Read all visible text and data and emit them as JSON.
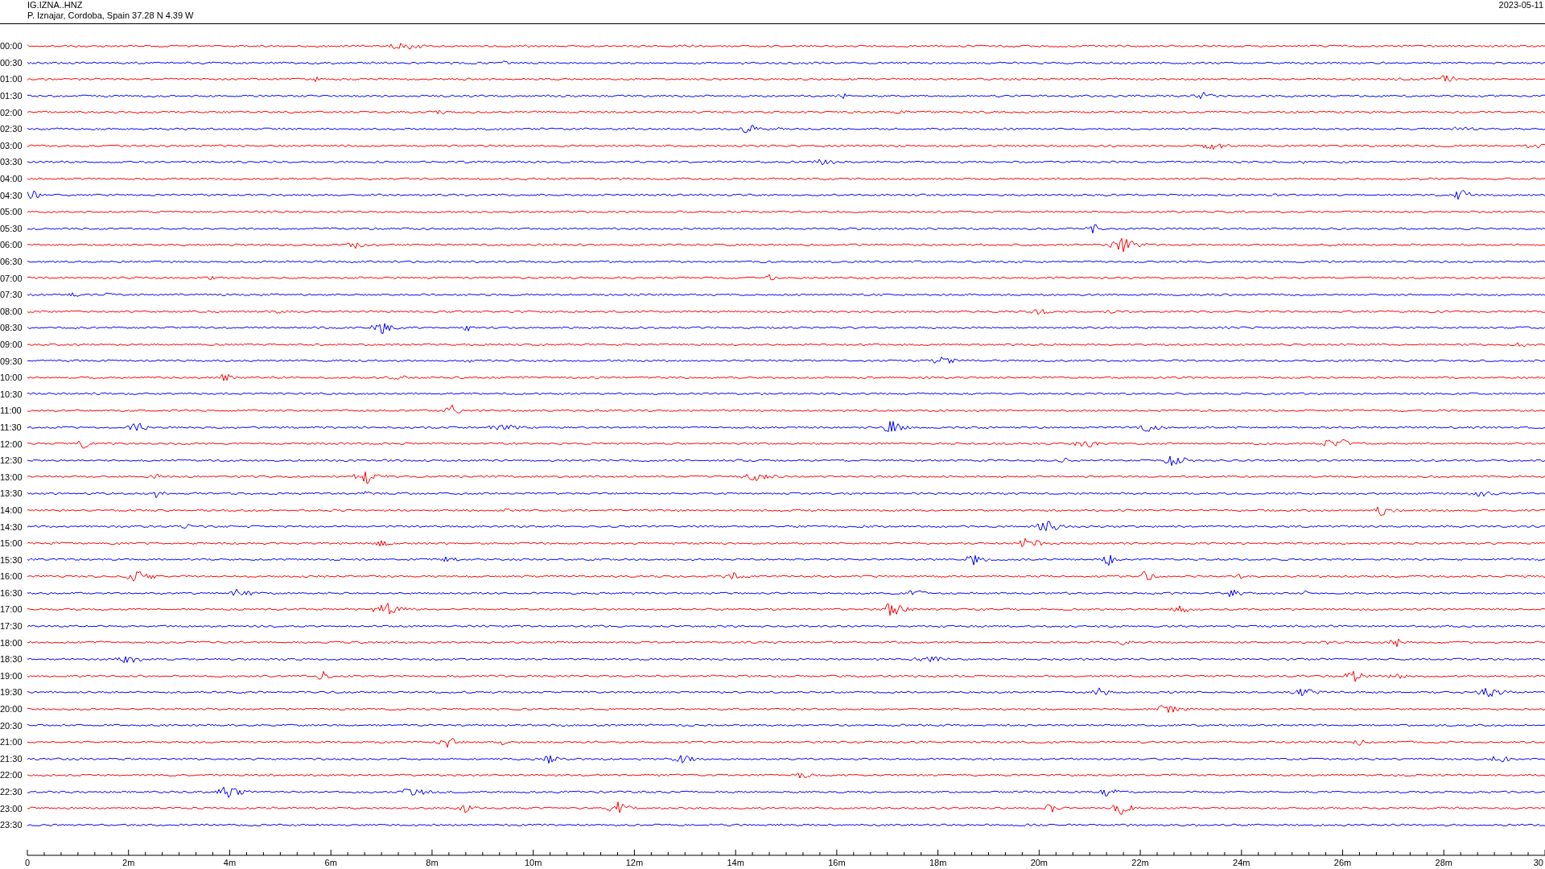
{
  "header": {
    "station": "IG.IZNA..HNZ",
    "location": "P. Iznajar, Cordoba, Spain  37.28 N 4.39 W",
    "date": "2023-05-11"
  },
  "rows": [
    {
      "label": "00:00",
      "color": "#ff0000"
    },
    {
      "label": "00:30",
      "color": "#0000ff"
    },
    {
      "label": "01:00",
      "color": "#ff0000"
    },
    {
      "label": "01:30",
      "color": "#0000ff"
    },
    {
      "label": "02:00",
      "color": "#ff0000"
    },
    {
      "label": "02:30",
      "color": "#0000ff"
    },
    {
      "label": "03:00",
      "color": "#ff0000"
    },
    {
      "label": "03:30",
      "color": "#0000ff"
    },
    {
      "label": "04:00",
      "color": "#ff0000"
    },
    {
      "label": "04:30",
      "color": "#0000ff"
    },
    {
      "label": "05:00",
      "color": "#ff0000"
    },
    {
      "label": "05:30",
      "color": "#0000ff"
    },
    {
      "label": "06:00",
      "color": "#ff0000"
    },
    {
      "label": "06:30",
      "color": "#0000ff"
    },
    {
      "label": "07:00",
      "color": "#ff0000"
    },
    {
      "label": "07:30",
      "color": "#0000ff"
    },
    {
      "label": "08:00",
      "color": "#ff0000"
    },
    {
      "label": "08:30",
      "color": "#0000ff"
    },
    {
      "label": "09:00",
      "color": "#ff0000"
    },
    {
      "label": "09:30",
      "color": "#0000ff"
    },
    {
      "label": "10:00",
      "color": "#ff0000"
    },
    {
      "label": "10:30",
      "color": "#0000ff"
    },
    {
      "label": "11:00",
      "color": "#ff0000"
    },
    {
      "label": "11:30",
      "color": "#0000ff"
    },
    {
      "label": "12:00",
      "color": "#ff0000"
    },
    {
      "label": "12:30",
      "color": "#0000ff"
    },
    {
      "label": "13:00",
      "color": "#ff0000"
    },
    {
      "label": "13:30",
      "color": "#0000ff"
    },
    {
      "label": "14:00",
      "color": "#ff0000"
    },
    {
      "label": "14:30",
      "color": "#0000ff"
    },
    {
      "label": "15:00",
      "color": "#ff0000"
    },
    {
      "label": "15:30",
      "color": "#0000ff"
    },
    {
      "label": "16:00",
      "color": "#ff0000"
    },
    {
      "label": "16:30",
      "color": "#0000ff"
    },
    {
      "label": "17:00",
      "color": "#ff0000"
    },
    {
      "label": "17:30",
      "color": "#0000ff"
    },
    {
      "label": "18:00",
      "color": "#ff0000"
    },
    {
      "label": "18:30",
      "color": "#0000ff"
    },
    {
      "label": "19:00",
      "color": "#ff0000"
    },
    {
      "label": "19:30",
      "color": "#0000ff"
    },
    {
      "label": "20:00",
      "color": "#ff0000"
    },
    {
      "label": "20:30",
      "color": "#0000ff"
    },
    {
      "label": "21:00",
      "color": "#ff0000"
    },
    {
      "label": "21:30",
      "color": "#0000ff"
    },
    {
      "label": "22:00",
      "color": "#ff0000"
    },
    {
      "label": "22:30",
      "color": "#0000ff"
    },
    {
      "label": "23:00",
      "color": "#ff0000"
    },
    {
      "label": "23:30",
      "color": "#0000ff"
    }
  ],
  "axis": {
    "ticks": [
      "0",
      "2m",
      "4m",
      "6m",
      "8m",
      "10m",
      "12m",
      "14m",
      "16m",
      "18m",
      "20m",
      "22m",
      "24m",
      "26m",
      "28m",
      "30"
    ]
  }
}
